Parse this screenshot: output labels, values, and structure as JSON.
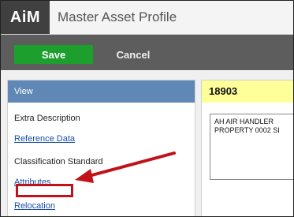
{
  "header": {
    "logo": "AiM",
    "title": "Master Asset Profile"
  },
  "toolbar": {
    "save_label": "Save",
    "cancel_label": "Cancel"
  },
  "view_panel": {
    "title": "View",
    "items": [
      {
        "label": "Extra Description"
      },
      {
        "label": "Reference Data"
      },
      {
        "label": "Classification Standard"
      },
      {
        "label": "Attributes"
      },
      {
        "label": "Relocation"
      }
    ]
  },
  "detail": {
    "asset_id": "18903",
    "description_lines": [
      "AH AIR HANDLER",
      "PROPERTY 0002 SI"
    ]
  },
  "colors": {
    "save_green": "#1d9f2e",
    "view_header_blue": "#5f88b6",
    "id_highlight_yellow": "#ffff99",
    "callout_red": "#c1121a"
  }
}
